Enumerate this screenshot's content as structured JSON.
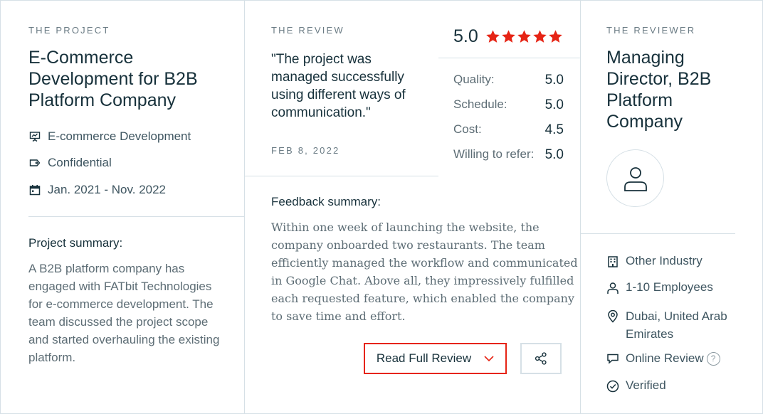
{
  "project": {
    "eyebrow": "THE PROJECT",
    "title_lines": [
      "E-Commerce",
      "Development for B2B",
      "Platform Company"
    ],
    "service": "E-commerce Development",
    "budget": "Confidential",
    "dates": "Jan. 2021 - Nov. 2022",
    "summary_heading": "Project summary:",
    "summary_lines": [
      "A B2B platform company has",
      "engaged with FATbit Technologies",
      "for e-commerce development. The",
      "team discussed the project scope",
      "and started overhauling the existing",
      "platform."
    ]
  },
  "review": {
    "eyebrow": "THE REVIEW",
    "quote_lines": [
      "\"The project was",
      "managed successfully",
      "using different ways of",
      "communication.\""
    ],
    "date": "FEB 8, 2022",
    "overall": "5.0",
    "stars": 5,
    "star_color": "#e62415",
    "scores": [
      {
        "label": "Quality:",
        "value": "5.0"
      },
      {
        "label": "Schedule:",
        "value": "5.0"
      },
      {
        "label": "Cost:",
        "value": "4.5"
      },
      {
        "label": "Willing to refer:",
        "value": "5.0"
      }
    ],
    "feedback_heading": "Feedback summary:",
    "feedback_lines": [
      "Within one week of launching the website, the",
      "company onboarded two restaurants. The team",
      "efficiently managed the workflow and communicated",
      "in Google Chat. Above all, they impressively fulfilled",
      "each requested feature, which enabled the company",
      "to save time and effort."
    ],
    "read_full_label": "Read Full Review",
    "accent_color": "#e62415"
  },
  "reviewer": {
    "eyebrow": "THE REVIEWER",
    "title_lines": [
      "Managing",
      "Director, B2B",
      "Platform",
      "Company"
    ],
    "industry": "Other Industry",
    "employees": "1-10 Employees",
    "location_lines": [
      "Dubai, United Arab",
      "Emirates"
    ],
    "review_type": "Online Review",
    "help_glyph": "?",
    "verified": "Verified"
  }
}
